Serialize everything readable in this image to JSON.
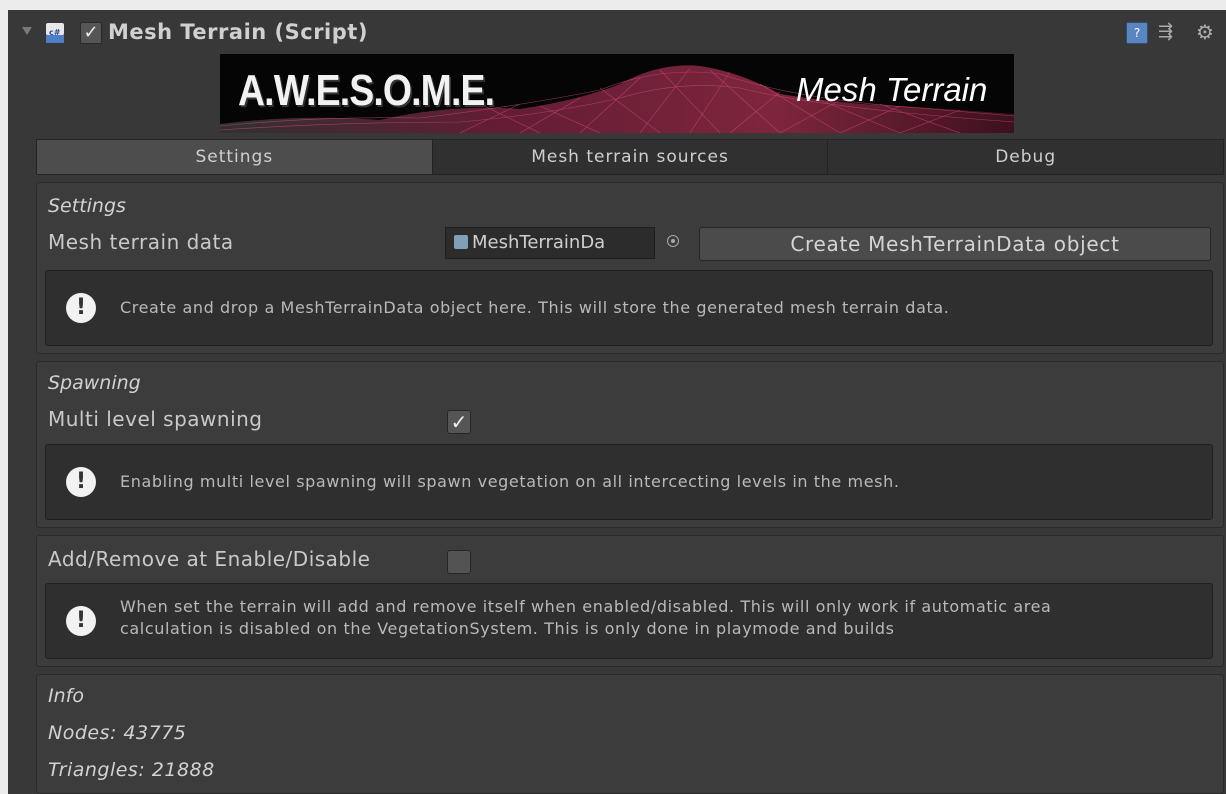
{
  "header": {
    "title": "Mesh Terrain (Script)",
    "cs_icon_text": "c#"
  },
  "banner": {
    "left_text": "A.W.E.S.O.M.E.",
    "right_text": "Mesh Terrain"
  },
  "tabs": [
    {
      "label": "Settings",
      "active": true
    },
    {
      "label": "Mesh terrain sources",
      "active": false
    },
    {
      "label": "Debug",
      "active": false
    }
  ],
  "settings": {
    "title": "Settings",
    "mesh_data_label": "Mesh terrain data",
    "mesh_data_value": "MeshTerrainDa",
    "create_button": "Create MeshTerrainData object",
    "help_text": "Create and drop a MeshTerrainData object here. This will store the generated mesh terrain data."
  },
  "spawning": {
    "title": "Spawning",
    "multi_level_label": "Multi level spawning",
    "multi_level_checked": true,
    "help_text": "Enabling multi level spawning will spawn vegetation on all intercecting levels in the mesh."
  },
  "enable": {
    "label": "Add/Remove at Enable/Disable",
    "checked": false,
    "help_line1": "When set the terrain will add and remove itself when enabled/disabled. This will only work if automatic area",
    "help_line2": "calculation is disabled on the VegetationSystem. This is only done in playmode and builds"
  },
  "info": {
    "title": "Info",
    "nodes": "Nodes: 43775",
    "triangles": "Triangles: 21888"
  },
  "icons": {
    "info": "!",
    "check": "✓"
  }
}
